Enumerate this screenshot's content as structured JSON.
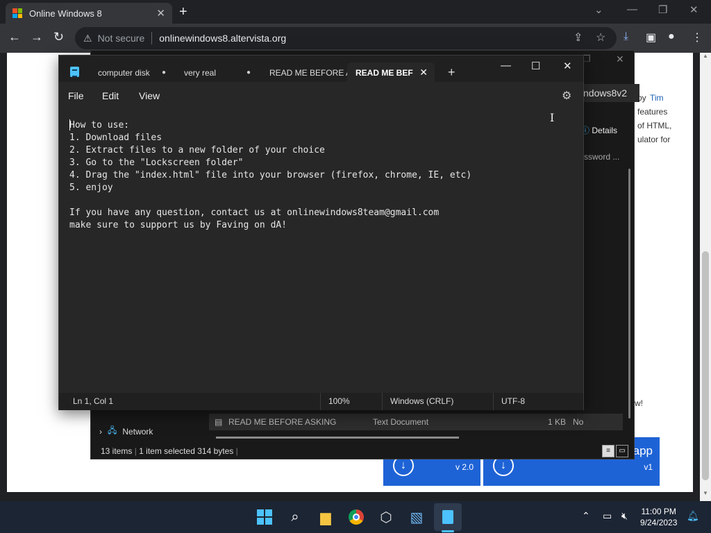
{
  "browser": {
    "tab_title": "Online Windows 8",
    "security_label": "Not secure",
    "url": "onlinewindows8.altervista.org"
  },
  "website": {
    "byline_by": "by",
    "byline_author": "Tim",
    "text_lines": [
      "features",
      "of HTML,",
      "ulator for"
    ],
    "trailing_text": "w!",
    "tiles": [
      {
        "version": "v 2.0"
      },
      {
        "label_fragment": "app",
        "version": "v1"
      }
    ]
  },
  "explorer": {
    "address_fragment": "ewindows8v2",
    "details_label": "Details",
    "search_fragment": "ssword ...",
    "nav_network": "Network",
    "file_row": {
      "name": "READ ME BEFORE ASKING",
      "type": "Text Document",
      "size": "1 KB",
      "extra": "No"
    },
    "status": {
      "items": "13 items",
      "selected": "1 item selected",
      "bytes": "314 bytes"
    }
  },
  "notepad": {
    "tabs": [
      {
        "label": "computer disk",
        "modified": true
      },
      {
        "label": "very real",
        "modified": true
      },
      {
        "label": "READ ME BEFORE AS",
        "modified": false
      },
      {
        "label": "READ ME BEF",
        "active": true
      }
    ],
    "menu": {
      "file": "File",
      "edit": "Edit",
      "view": "View"
    },
    "content": "How to use:\n1. Download files\n2. Extract files to a new folder of your choice\n3. Go to the \"Lockscreen folder\"\n4. Drag the \"index.html\" file into your browser (firefox, chrome, IE, etc)\n5. enjoy\n\nIf you have any question, contact us at onlinewindows8team@gmail.com\nmake sure to support us by Faving on dA!",
    "status": {
      "position": "Ln 1, Col 1",
      "zoom": "100%",
      "line_ending": "Windows (CRLF)",
      "encoding": "UTF-8"
    }
  },
  "taskbar": {
    "time": "11:00 PM",
    "date": "9/24/2023"
  },
  "colors": {
    "accent": "#4cc2ff",
    "tile_blue": "#1e63d6",
    "notepad_bg": "#272727"
  }
}
